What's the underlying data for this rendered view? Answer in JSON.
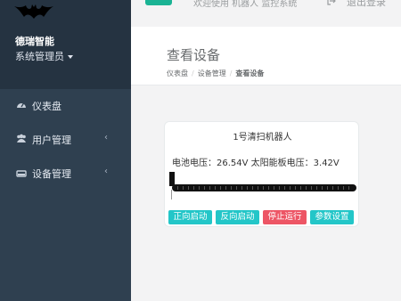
{
  "sidebar": {
    "brand": "德瑞智能",
    "role": "系统管理员",
    "items": [
      {
        "label": "仪表盘",
        "icon": "dashboard-icon"
      },
      {
        "label": "用户管理",
        "icon": "users-icon",
        "chevron": "‹"
      },
      {
        "label": "设备管理",
        "icon": "hdd-icon",
        "chevron": "‹"
      }
    ]
  },
  "topbar": {
    "welcome": "欢迎使用 机器人 监控系统",
    "logout": "退出登录"
  },
  "heading": {
    "title": "查看设备",
    "breadcrumb": [
      "仪表盘",
      "设备管理",
      "查看设备"
    ]
  },
  "device": {
    "name": "1号清扫机器人",
    "battery_label": "电池电压：",
    "battery_value": "26.54V",
    "solar_label": "太阳能板电压：",
    "solar_value": "3.42V",
    "buttons": {
      "forward": "正向启动",
      "reverse": "反向启动",
      "stop": "停止运行",
      "params": "参数设置"
    }
  },
  "colors": {
    "sidebar": "#2f4050",
    "primary": "#1ab394",
    "info": "#23c6c8",
    "danger": "#ed5565"
  }
}
